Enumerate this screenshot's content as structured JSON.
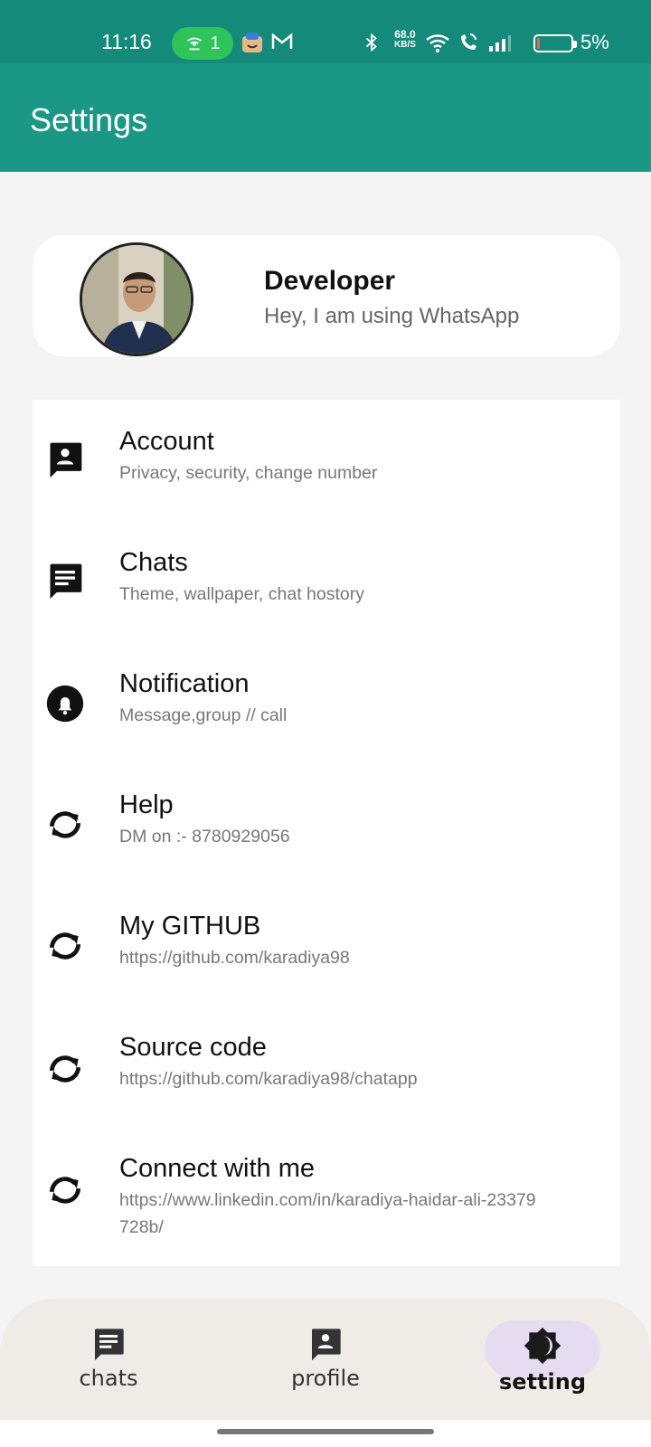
{
  "status_bar": {
    "time": "11:16",
    "hotspot_count": "1",
    "net_speed_value": "68.0",
    "net_speed_unit": "KB/S",
    "battery_percent": "5%"
  },
  "app_bar": {
    "title": "Settings"
  },
  "profile": {
    "name": "Developer",
    "status": "Hey, I am using WhatsApp"
  },
  "settings": [
    {
      "title": "Account",
      "subtitle": "Privacy, security, change number",
      "icon": "account-icon"
    },
    {
      "title": "Chats",
      "subtitle": "Theme, wallpaper, chat hostory",
      "icon": "chat-icon"
    },
    {
      "title": "Notification",
      "subtitle": "Message,group // call",
      "icon": "bell-icon"
    },
    {
      "title": "Help",
      "subtitle": "DM on :- 8780929056",
      "icon": "sync-icon"
    },
    {
      "title": "My GITHUB",
      "subtitle": "https://github.com/karadiya98",
      "icon": "sync-icon"
    },
    {
      "title": "Source code",
      "subtitle": "https://github.com/karadiya98/chatapp",
      "icon": "sync-icon"
    },
    {
      "title": "Connect with me",
      "subtitle": "https://www.linkedin.com/in/karadiya-haidar-ali-23379728b/",
      "icon": "sync-icon"
    }
  ],
  "bottom_nav": [
    {
      "label": "chats",
      "icon": "chat-icon",
      "active": false
    },
    {
      "label": "profile",
      "icon": "account-icon",
      "active": false
    },
    {
      "label": "setting",
      "icon": "brightness-icon",
      "active": true
    }
  ],
  "colors": {
    "status_bar": "#148a7a",
    "app_bar": "#1a9885",
    "active_nav_pill": "#e6dcf2"
  }
}
